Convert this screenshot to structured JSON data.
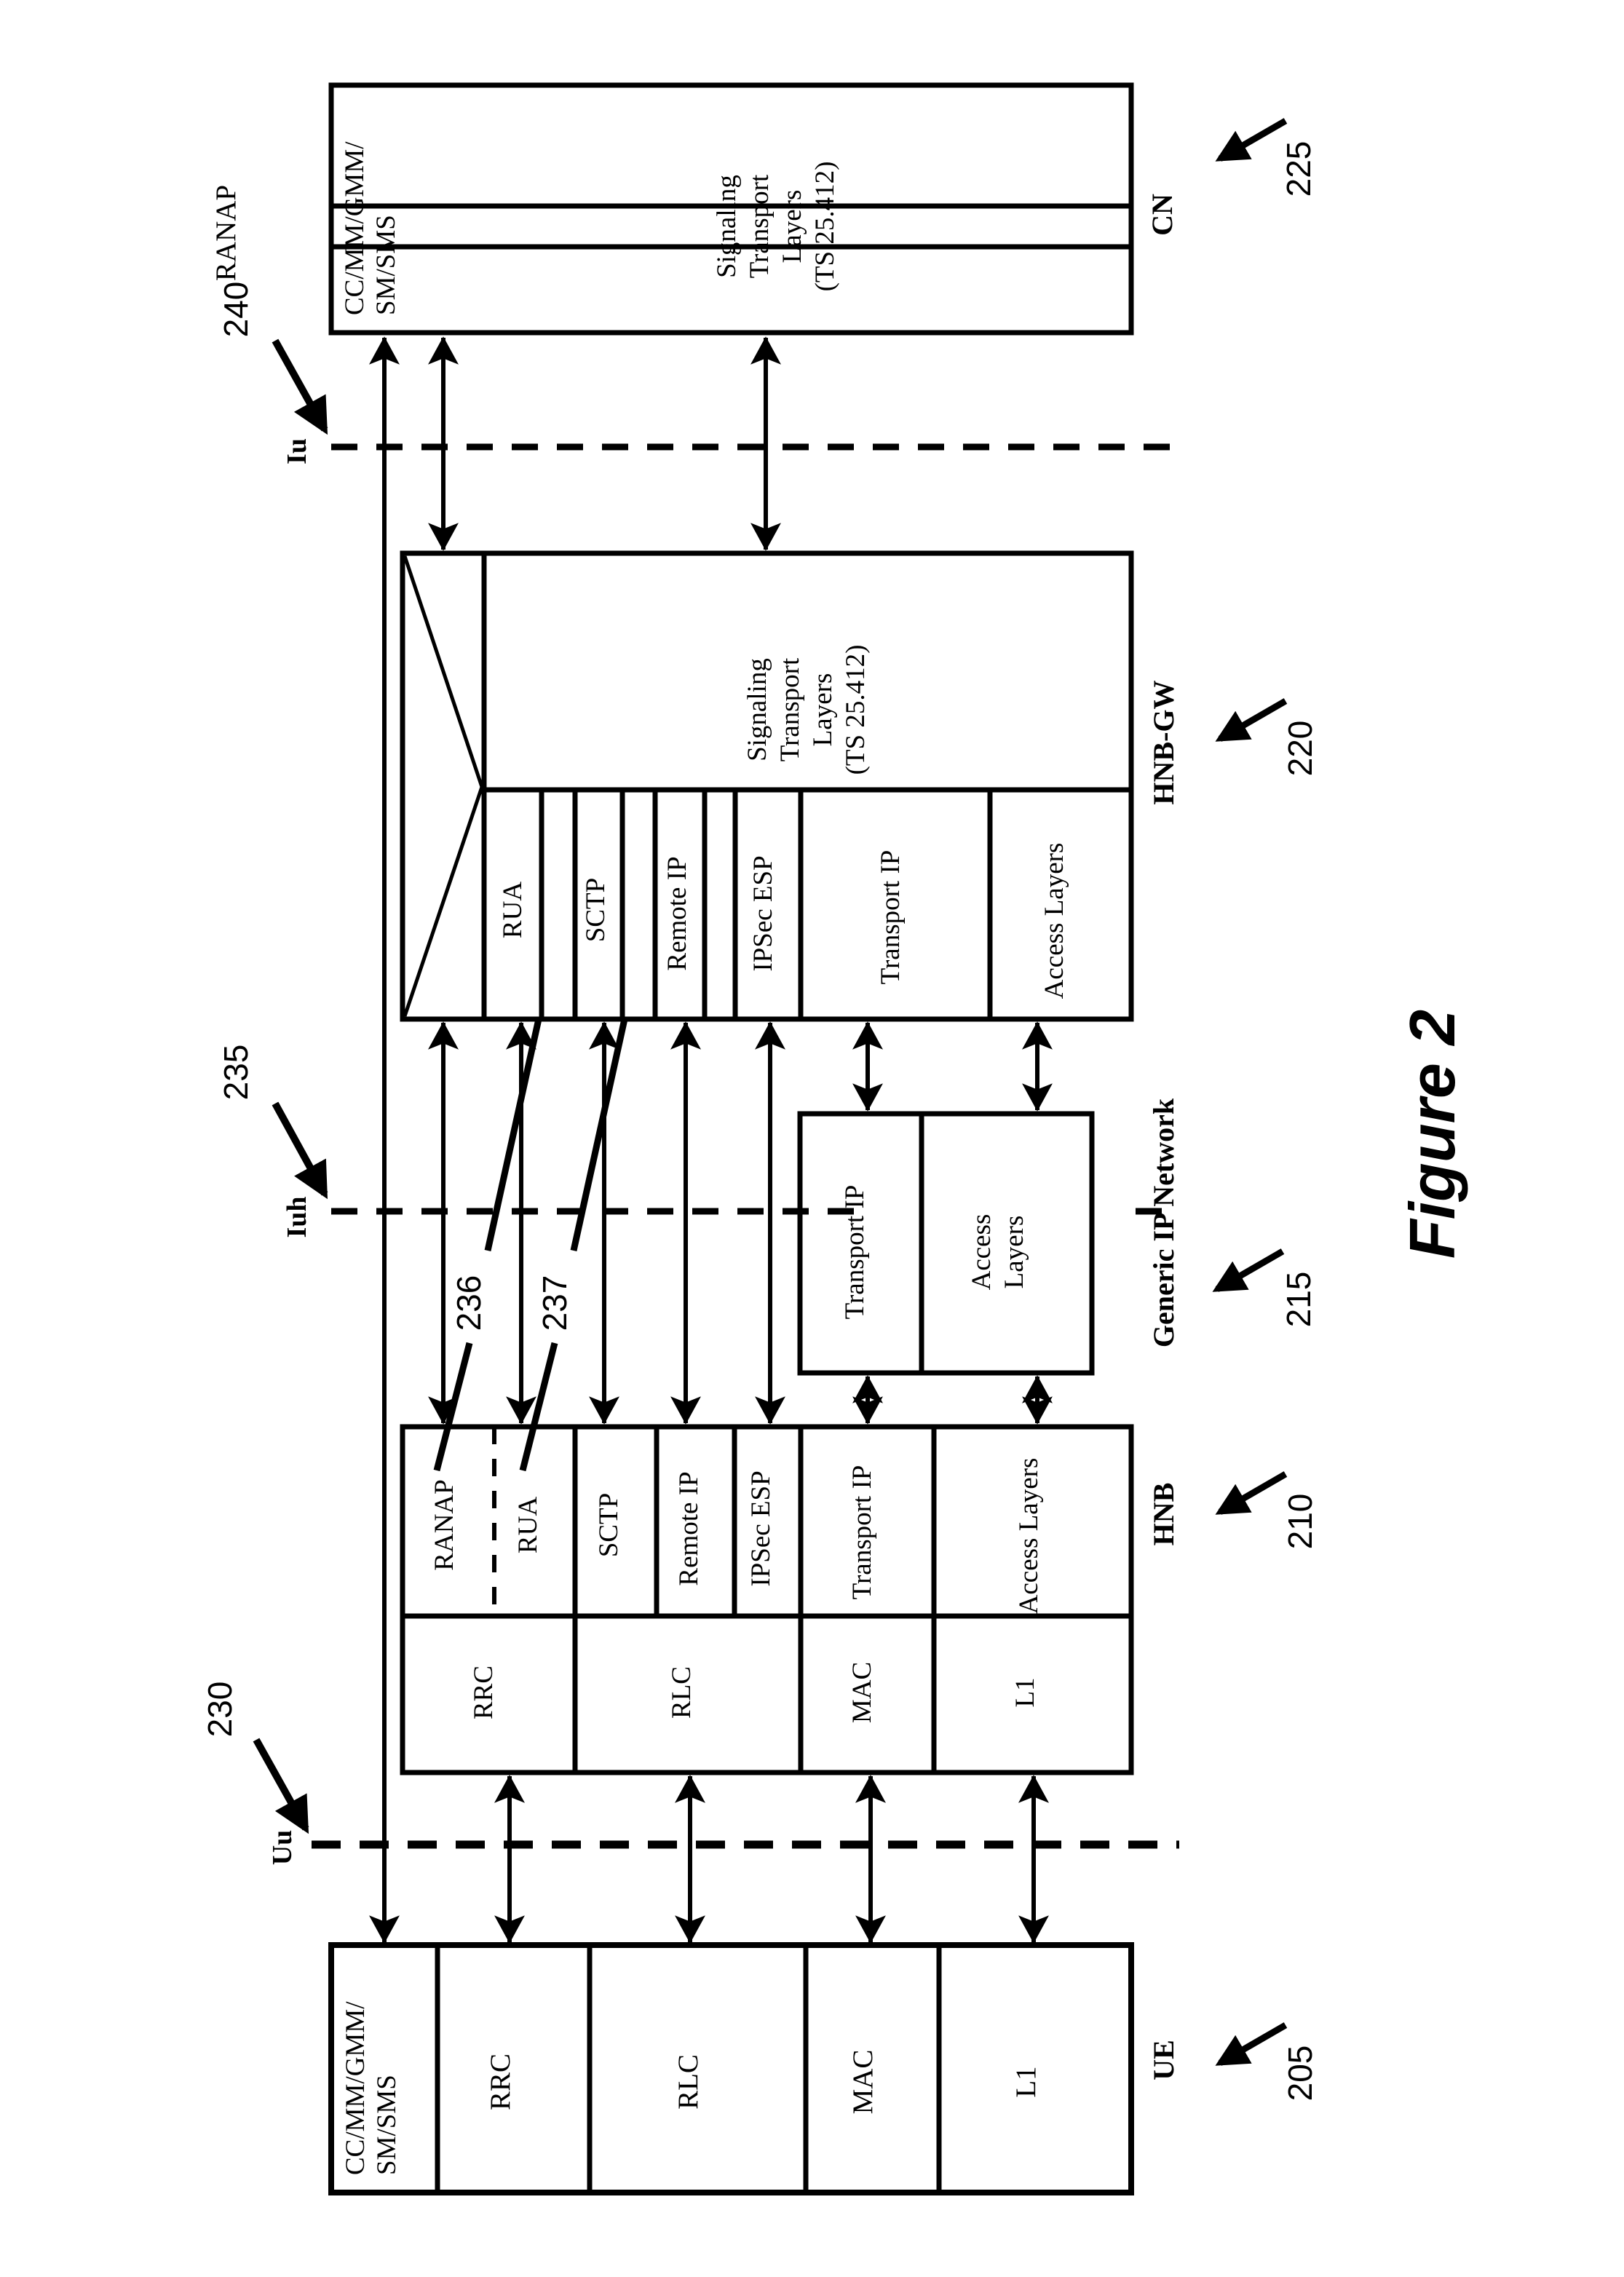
{
  "figure": {
    "caption": "Figure 2",
    "type": "protocol-stack-diagram"
  },
  "nodes": {
    "cn": {
      "name": "CN",
      "ref": "225",
      "layers": [
        {
          "id": "cc-mm-gmm-sm-sms",
          "label_line1": "CC/MM/GMM/",
          "label_line2": "SM/SMS"
        },
        {
          "id": "ranap",
          "label": "RANAP"
        },
        {
          "id": "signaling-transport-layers",
          "label_line1": "Signaling",
          "label_line2": "Transport",
          "label_line3": "Layers",
          "label_line4": "(TS 25.412)"
        }
      ]
    },
    "hnbgw": {
      "name": "HNB-GW",
      "ref": "220",
      "relay_cell": {
        "id": "relay-bowtie",
        "label": ""
      },
      "upper_layers": [
        {
          "id": "signaling-transport-layers",
          "label_line1": "Signaling",
          "label_line2": "Transport",
          "label_line3": "Layers",
          "label_line4": "(TS 25.412)"
        }
      ],
      "lower_layers": [
        {
          "id": "rua",
          "label": "RUA"
        },
        {
          "id": "sctp",
          "label": "SCTP"
        },
        {
          "id": "remote-ip",
          "label": "Remote IP"
        },
        {
          "id": "ipsec-esp",
          "label": "IPSec ESP"
        },
        {
          "id": "transport-ip",
          "label": "Transport IP"
        },
        {
          "id": "access-layers",
          "label": "Access Layers"
        }
      ]
    },
    "genericip": {
      "name": "Generic IP Network",
      "ref": "215",
      "layers": [
        {
          "id": "transport-ip",
          "label": "Transport IP"
        },
        {
          "id": "access-layers",
          "label_line1": "Access",
          "label_line2": "Layers"
        }
      ]
    },
    "hnb": {
      "name": "HNB",
      "ref": "210",
      "upper_layers": [
        {
          "id": "ranap",
          "label": "RANAP"
        },
        {
          "id": "rua",
          "label": "RUA"
        },
        {
          "id": "sctp",
          "label": "SCTP"
        },
        {
          "id": "remote-ip",
          "label": "Remote IP"
        },
        {
          "id": "ipsec-esp",
          "label": "IPSec ESP"
        },
        {
          "id": "transport-ip",
          "label": "Transport IP"
        },
        {
          "id": "access-layers",
          "label": "Access Layers"
        }
      ],
      "lower_layers": [
        {
          "id": "rrc",
          "label": "RRC"
        },
        {
          "id": "rlc",
          "label": "RLC"
        },
        {
          "id": "mac",
          "label": "MAC"
        },
        {
          "id": "l1",
          "label": "L1"
        }
      ]
    },
    "ue": {
      "name": "UE",
      "ref": "205",
      "layers": [
        {
          "id": "cc-mm-gmm-sm-sms",
          "label_line1": "CC/MM/GMM/",
          "label_line2": "SM/SMS"
        },
        {
          "id": "rrc",
          "label": "RRC"
        },
        {
          "id": "rlc",
          "label": "RLC"
        },
        {
          "id": "mac",
          "label": "MAC"
        },
        {
          "id": "l1",
          "label": "L1"
        }
      ]
    }
  },
  "interfaces": [
    {
      "id": "iu",
      "label": "Iu",
      "ref": "240"
    },
    {
      "id": "iuh",
      "label": "Iuh",
      "ref": "235"
    },
    {
      "id": "uu",
      "label": "Uu",
      "ref": "230"
    }
  ],
  "callouts": [
    {
      "id": "ranap-link",
      "ref": "236"
    },
    {
      "id": "rua-link",
      "ref": "237"
    }
  ],
  "colors": {
    "stroke": "#000000",
    "background": "#ffffff"
  }
}
